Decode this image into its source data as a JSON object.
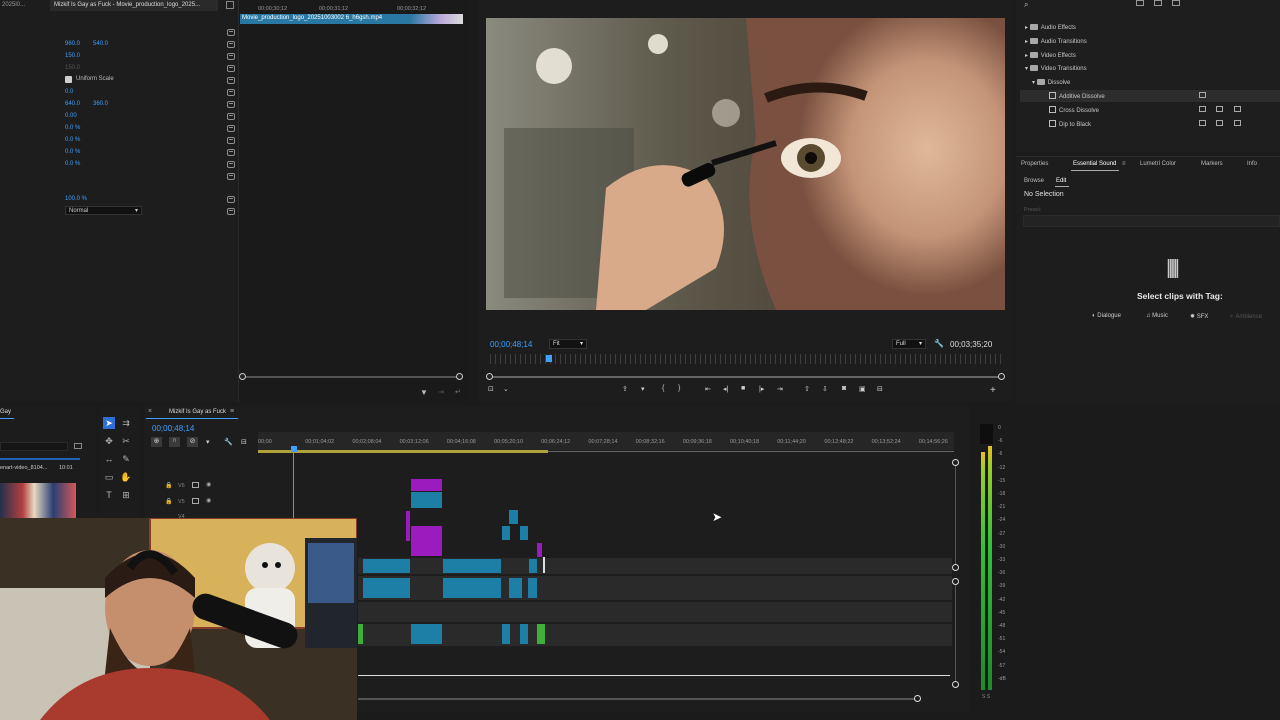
{
  "topbar": {
    "tab_left": "2025l0...",
    "tab_active": "Mizkif Is Gay as Fuck - Movie_production_logo_2025...",
    "source_times": [
      "00;00;30;12",
      "00;00;31;12",
      "00;00;32;12"
    ],
    "source_clip": "Movie_production_logo_20251003002 6_h6gsh.mp4"
  },
  "effect_controls": {
    "position": [
      "960.0",
      "540.0"
    ],
    "scale": "150.0",
    "scale_width": "150.0",
    "uniform_scale": "Uniform Scale",
    "rotation": "0.0",
    "anchor": [
      "640.0",
      "360.0"
    ],
    "anti_flicker": "0.00",
    "crop": [
      "0.0 %",
      "0.0 %",
      "0.0 %",
      "0.0 %"
    ],
    "opacity": "100.0 %",
    "blend_mode": "Normal"
  },
  "program_monitor": {
    "timecode": "00;00;48;14",
    "fit": "Fit",
    "quality": "Full",
    "duration": "00;03;35;20"
  },
  "effects_panel": {
    "items": [
      {
        "label": "Audio Effects",
        "type": "folder"
      },
      {
        "label": "Audio Transitions",
        "type": "folder"
      },
      {
        "label": "Video Effects",
        "type": "folder"
      },
      {
        "label": "Video Transitions",
        "type": "folder"
      },
      {
        "label": "Dissolve",
        "type": "folder"
      },
      {
        "label": "Additive Dissolve",
        "type": "effect"
      },
      {
        "label": "Cross Dissolve",
        "type": "effect"
      },
      {
        "label": "Dip to Black",
        "type": "effect"
      }
    ]
  },
  "essential_sound": {
    "tabs": [
      "Properties",
      "Essential Sound",
      "Lumetri Color",
      "Markers",
      "Info"
    ],
    "subtabs": [
      "Browse",
      "Edit"
    ],
    "no_selection": "No Selection",
    "preset": "Preset:",
    "message": "Select clips with Tag:",
    "tags": [
      "Dialogue",
      "Music",
      "SFX",
      "Ambience"
    ]
  },
  "project": {
    "title": "Gay",
    "item": "enart-video_8104...",
    "item_duration": "10:01"
  },
  "timeline": {
    "sequence_name": "Mizkif Is Gay as Fuck",
    "timecode": "00;00;48;14",
    "ruler": [
      "00;00",
      "00;01;04;02",
      "00;02;08;04",
      "00;03;12;06",
      "00;04;16;08",
      "00;05;20;10",
      "00;06;24;12",
      "00;07;28;14",
      "00;08;32;16",
      "00;09;36;18",
      "00;10;40;18",
      "00;11;44;20",
      "00;12;48;22",
      "00;13;52;24",
      "00;14;56;26"
    ],
    "tracks": [
      "V6",
      "V5",
      "V4"
    ]
  },
  "audio_meter": {
    "labels": [
      "0",
      "-6",
      "-6",
      "-12",
      "-15",
      "-18",
      "-21",
      "-24",
      "-27",
      "-30",
      "-33",
      "-36",
      "-39",
      "-42",
      "-45",
      "-48",
      "-51",
      "-54",
      "-57",
      "-dB"
    ],
    "footer": "S  S"
  },
  "colors": {
    "accent": "#3ea0ff",
    "clip_purple": "#9b1bbf",
    "clip_teal": "#1e7fa6",
    "clip_green": "#3fae3a"
  }
}
